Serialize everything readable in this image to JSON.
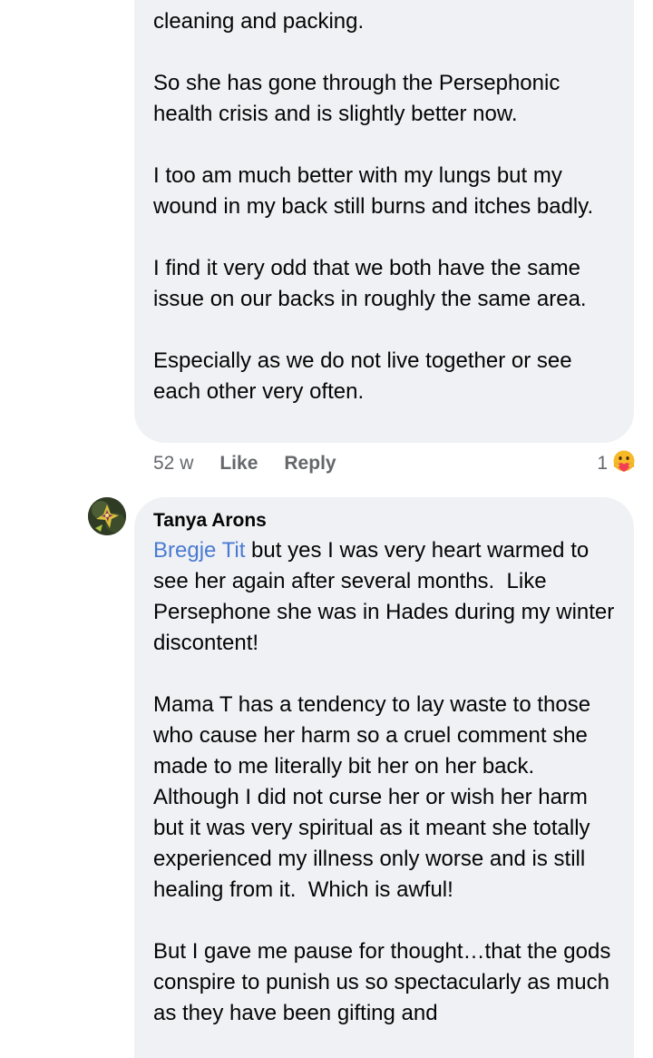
{
  "comment_prev": {
    "paragraphs": [
      "cleaning and packing.",
      "So she has gone through the Persephonic health crisis and is slightly better now.",
      "I too am much better with my lungs but my wound in my back still burns and itches badly.",
      "I find it very odd that we both have the same issue on our backs in roughly the same area.",
      "Especially as we do not live together or see each other very often."
    ],
    "time": "52 w",
    "like_label": "Like",
    "reply_label": "Reply",
    "reaction_count": "1",
    "reaction_icon": "care-emoji-icon"
  },
  "comment_next": {
    "author": "Tanya Arons",
    "mention": "Bregje Tit",
    "first_paragraph_rest": " but yes I was very heart warmed to see her again after several months.  Like Persephone she was in Hades during my winter discontent!",
    "paragraphs": [
      "Mama T has a tendency to lay waste to those who cause her harm so a cruel comment she made to me literally bit her on her back.  Although I did not curse her or wish her harm but it was very spiritual as it meant she totally experienced my illness only worse and is still healing from it.  Which is awful!",
      "But I gave me pause for thought…that the gods conspire to punish us so spectacularly as much as they have been gifting and"
    ],
    "avatar_icon": "avatar-icon"
  },
  "colors": {
    "bubble_bg": "#f0f1f5",
    "mention": "#4a7bd1",
    "meta_text": "#65676b"
  }
}
